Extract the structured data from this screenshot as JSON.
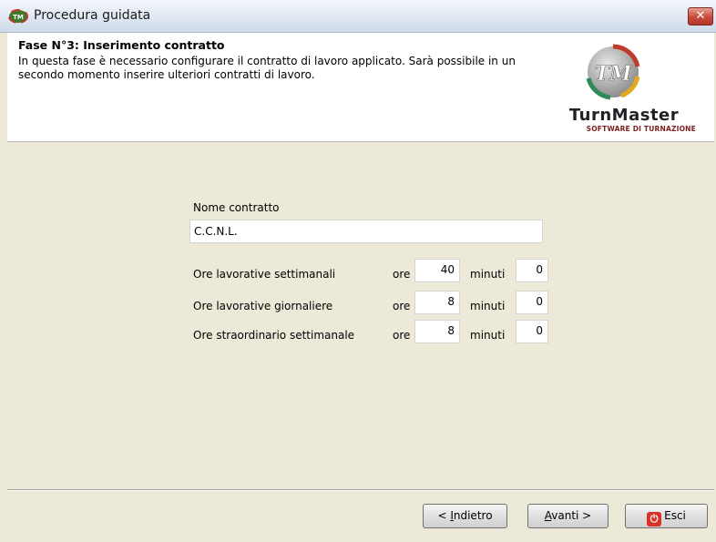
{
  "window": {
    "title": "Procedura guidata",
    "close_glyph": "✕"
  },
  "header": {
    "step_title": "Fase N°3: Inserimento contratto",
    "step_description_line1": "In questa fase è necessario configurare il contratto di lavoro applicato. Sarà possibile in un",
    "step_description_line2": "secondo momento inserire ulteriori contratti di lavoro.",
    "logo": {
      "badge_text": "TM",
      "name": "TurnMaster",
      "tagline": "SOFTWARE DI TURNAZIONE"
    }
  },
  "form": {
    "contract_name_label": "Nome contratto",
    "contract_name_value": "C.C.N.L.",
    "rows": [
      {
        "label": "Ore lavorative settimanali",
        "hours_label": "ore",
        "hours": "40",
        "minutes_label": "minuti",
        "minutes": "0"
      },
      {
        "label": "Ore lavorative giornaliere",
        "hours_label": "ore",
        "hours": "8",
        "minutes_label": "minuti",
        "minutes": "0"
      },
      {
        "label": "Ore straordinario settimanale",
        "hours_label": "ore",
        "hours": "8",
        "minutes_label": "minuti",
        "minutes": "0"
      }
    ]
  },
  "footer": {
    "back_prefix": "< ",
    "back_accel": "I",
    "back_rest": "ndietro",
    "next_accel": "A",
    "next_rest": "vanti >",
    "exit_label": "Esci",
    "exit_icon_glyph": "⏻"
  },
  "colors": {
    "window_bg": "#ece9d8",
    "exit_icon": "#d8322b",
    "logo_accent": "#7a1f1f"
  },
  "icons": {
    "app": "turnmaster-app-icon",
    "close": "close-icon",
    "exit": "power-icon",
    "logo": "turnmaster-logo-badge"
  }
}
